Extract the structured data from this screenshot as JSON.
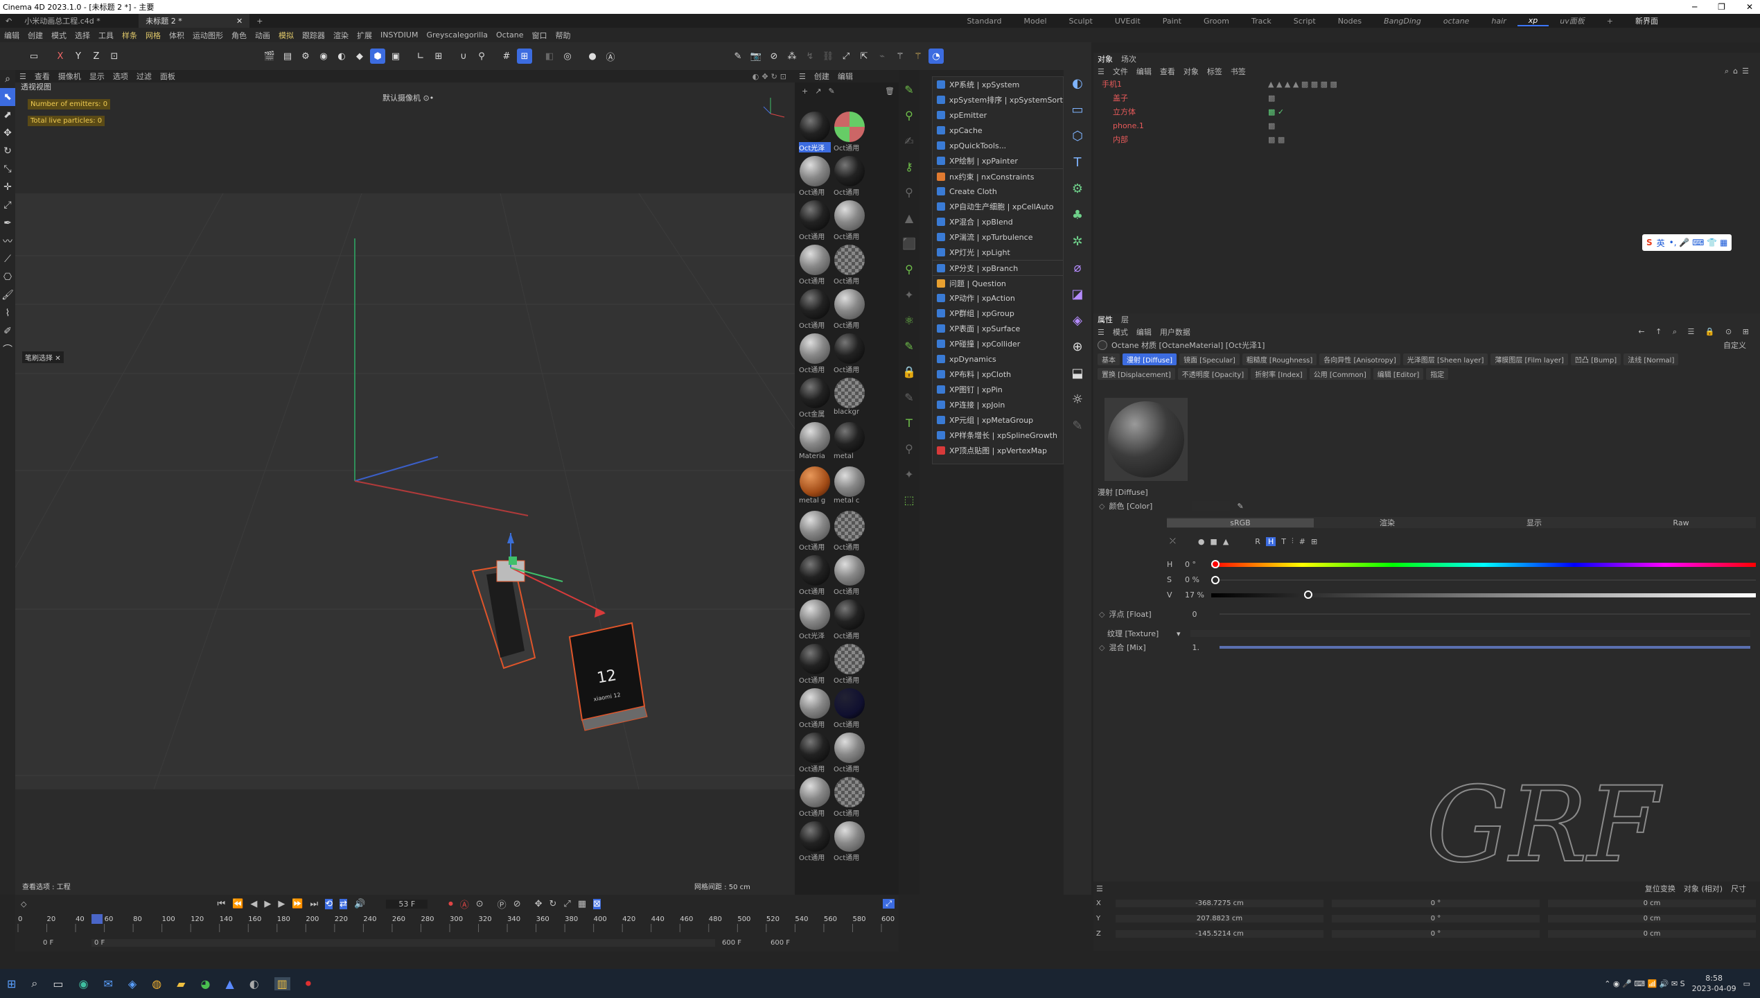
{
  "app": {
    "window_title": "Cinema 4D 2023.1.0 - [未标题 2 *] - 主要",
    "file_tabs": [
      "小米动画总工程.c4d *",
      "未标题 2 *"
    ],
    "layouts": [
      "Standard",
      "Model",
      "Sculpt",
      "UVEdit",
      "Paint",
      "Groom",
      "Track",
      "Script",
      "Nodes",
      "BangDing",
      "octane",
      "hair",
      "xp",
      "uv面板"
    ],
    "active_layout": "xp",
    "new_interface": "新界面",
    "window_controls": [
      "─",
      "❐",
      "✕"
    ]
  },
  "menubar": [
    "编辑",
    "创建",
    "模式",
    "选择",
    "工具",
    "样条",
    "网格",
    "体积",
    "运动图形",
    "角色",
    "动画",
    "模拟",
    "跟踪器",
    "渲染",
    "扩展",
    "INSYDIUM",
    "Greyscalegorilla",
    "Octane",
    "窗口",
    "帮助"
  ],
  "viewport": {
    "menu": [
      "查看",
      "摄像机",
      "显示",
      "选项",
      "过滤",
      "面板"
    ],
    "label": "透视视图",
    "camera": "默认摄像机 ⊙•",
    "hud": [
      "Number of emitters: 0",
      "Total live particles: 0"
    ],
    "grid_info": "网格间距 : 50 cm",
    "status": "查看选项 : 工程",
    "brush_tag": "笔刷选择",
    "phone_number": "12",
    "phone_brand": "xiaomi 12"
  },
  "materials": {
    "menu": [
      "创建",
      "编辑"
    ],
    "items": [
      [
        "Oct光泽",
        "Oct通用"
      ],
      [
        "Oct通用",
        "Oct通用"
      ],
      [
        "Oct通用",
        "Oct通用"
      ],
      [
        "Oct通用",
        "Oct通用"
      ],
      [
        "Oct通用",
        "Oct通用"
      ],
      [
        "Oct通用",
        "Oct通用"
      ],
      [
        "Oct金属",
        "blackgr"
      ],
      [
        "Materia",
        "metal"
      ],
      [
        "metal g",
        "metal c"
      ],
      [
        "Oct通用",
        "Oct通用"
      ],
      [
        "Oct通用",
        "Oct通用"
      ],
      [
        "Oct光泽",
        "Oct通用"
      ],
      [
        "Oct通用",
        "Oct通用"
      ],
      [
        "Oct通用",
        "Oct通用"
      ],
      [
        "Oct通用",
        "Oct通用"
      ],
      [
        "Oct通用",
        "Oct通用"
      ],
      [
        "Oct通用",
        "Oct通用"
      ]
    ]
  },
  "plugin_menu": [
    "XP系统 | xpSystem",
    "xpSystem排序 | xpSystemSort",
    "xpEmitter",
    "xpCache",
    "xpQuickTools...",
    "XP绘制 | xpPainter",
    "nx约束 | nxConstraints",
    "Create Cloth",
    "XP自动生产细胞 | xpCellAuto",
    "XP混合 | xpBlend",
    "XP湍流 | xpTurbulence",
    "XP灯光 | xpLight",
    "XP分支 | xpBranch",
    "问题 | Question",
    "XP动作 | xpAction",
    "XP群组 | xpGroup",
    "XP表面 | xpSurface",
    "XP碰撞 | xpCollider",
    "xpDynamics",
    "XP布料 | xpCloth",
    "XP图钉 | xpPin",
    "XP连接 | xpJoin",
    "XP元组 | xpMetaGroup",
    "XP样条增长 | xpSplineGrowth",
    "XP顶点贴图 | xpVertexMap"
  ],
  "objects": {
    "tabs": [
      "对象",
      "场次"
    ],
    "menu": [
      "文件",
      "编辑",
      "查看",
      "对象",
      "标签",
      "书签"
    ],
    "tree": [
      "手机1",
      "盖子",
      "立方体",
      "phone.1",
      "内部"
    ]
  },
  "ime": {
    "label": "英"
  },
  "attributes": {
    "tabs": [
      "属性",
      "层"
    ],
    "menu": [
      "模式",
      "编辑",
      "用户数据"
    ],
    "material_title": "Octane 材质 [OctaneMaterial] [Oct光泽1]",
    "preset": "自定义",
    "chan_tabs_row1": [
      "基本",
      "漫射 [Diffuse]",
      "镜面 [Specular]",
      "粗糙度 [Roughness]",
      "各向异性 [Anisotropy]",
      "光泽图层 [Sheen layer]",
      "薄膜图层 [Film layer]",
      "凹凸 [Bump]",
      "法线 [Normal]"
    ],
    "chan_tabs_row2": [
      "置换 [Displacement]",
      "不透明度 [Opacity]",
      "折射率 [Index]",
      "公用 [Common]",
      "编辑 [Editor]",
      "指定"
    ],
    "active_tab": "漫射 [Diffuse]",
    "section": "漫射 [Diffuse]",
    "color_label": "颜色 [Color]",
    "color_modes": [
      "sRGB",
      "渲染",
      "显示",
      "Raw"
    ],
    "mode_buttons": [
      "R",
      "H",
      "T"
    ],
    "h_label": "H",
    "h_value": "0 °",
    "s_label": "S",
    "s_value": "0 %",
    "v_label": "V",
    "v_value": "17 %",
    "float_label": "浮点 [Float]",
    "float_value": "0",
    "texture_label": "纹理 [Texture]",
    "mix_label": "混合 [Mix]",
    "mix_value": "1."
  },
  "coords": {
    "toolbar": [
      "复位变换",
      "对象 (相对)",
      "尺寸"
    ],
    "rows": [
      {
        "axis": "X",
        "pos": "-368.7275 cm",
        "rot": "0 °",
        "size": "0 cm"
      },
      {
        "axis": "Y",
        "pos": "207.8823 cm",
        "rot": "0 °",
        "size": "0 cm"
      },
      {
        "axis": "Z",
        "pos": "-145.5214 cm",
        "rot": "0 °",
        "size": "0 cm"
      }
    ]
  },
  "timeline": {
    "current_frame": "53 F",
    "ticks": [
      "0",
      "20",
      "40",
      "60",
      "80",
      "100",
      "120",
      "140",
      "160",
      "180",
      "200",
      "220",
      "240",
      "260",
      "280",
      "300",
      "320",
      "340",
      "360",
      "380",
      "400",
      "420",
      "440",
      "460",
      "480",
      "500",
      "520",
      "540",
      "560",
      "580",
      "600"
    ],
    "playhead": 53,
    "max_frame": 600,
    "start": "0 F",
    "min_frame": "0 F",
    "end": "600 F",
    "end2": "600 F"
  },
  "watermark": "GRF",
  "taskbar": {
    "time": "8:58",
    "date": "2023-04-09"
  }
}
